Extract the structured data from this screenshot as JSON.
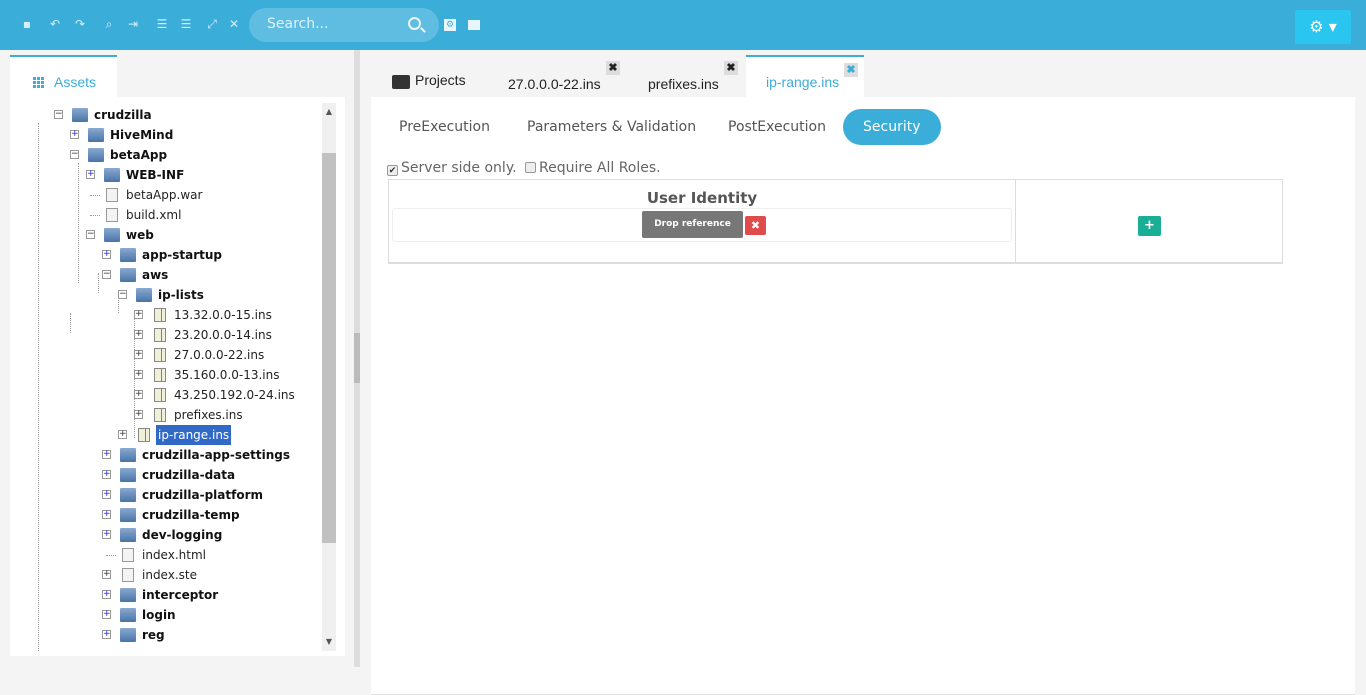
{
  "toolbar": {
    "icons": [
      "save-icon",
      "undo-icon",
      "redo-icon",
      "find-icon",
      "indent-icon",
      "align-left-icon",
      "align-right-icon",
      "expand-icon",
      "collapse-icon"
    ],
    "search_placeholder": "Search...",
    "settings_icon": "⚙ ▾"
  },
  "left": {
    "tab_label": "Assets",
    "tree": [
      {
        "level": 0,
        "toggle": "minus",
        "icon": "folder",
        "bold": true,
        "label": "crudzilla"
      },
      {
        "level": 1,
        "toggle": "plus",
        "icon": "folder-app",
        "bold": true,
        "label": "HiveMind"
      },
      {
        "level": 1,
        "toggle": "minus",
        "icon": "folder-app",
        "bold": true,
        "label": "betaApp"
      },
      {
        "level": 2,
        "toggle": "plus",
        "icon": "folder",
        "bold": true,
        "label": "WEB-INF"
      },
      {
        "level": 2,
        "toggle": "none",
        "icon": "file",
        "bold": false,
        "label": "betaApp.war"
      },
      {
        "level": 2,
        "toggle": "none",
        "icon": "xml",
        "bold": false,
        "label": "build.xml"
      },
      {
        "level": 2,
        "toggle": "minus",
        "icon": "folder-web",
        "bold": true,
        "label": "web"
      },
      {
        "level": 3,
        "toggle": "plus",
        "icon": "folder",
        "bold": true,
        "label": "app-startup"
      },
      {
        "level": 3,
        "toggle": "minus",
        "icon": "folder",
        "bold": true,
        "label": "aws"
      },
      {
        "level": 4,
        "toggle": "minus",
        "icon": "folder",
        "bold": true,
        "label": "ip-lists"
      },
      {
        "level": 5,
        "toggle": "plus",
        "icon": "ins",
        "bold": false,
        "label": "13.32.0.0-15.ins"
      },
      {
        "level": 5,
        "toggle": "plus",
        "icon": "ins",
        "bold": false,
        "label": "23.20.0.0-14.ins"
      },
      {
        "level": 5,
        "toggle": "plus",
        "icon": "ins",
        "bold": false,
        "label": "27.0.0.0-22.ins"
      },
      {
        "level": 5,
        "toggle": "plus",
        "icon": "ins",
        "bold": false,
        "label": "35.160.0.0-13.ins"
      },
      {
        "level": 5,
        "toggle": "plus",
        "icon": "ins",
        "bold": false,
        "label": "43.250.192.0-24.ins"
      },
      {
        "level": 5,
        "toggle": "plus",
        "icon": "ins",
        "bold": false,
        "label": "prefixes.ins"
      },
      {
        "level": 4,
        "toggle": "plus",
        "icon": "ins",
        "bold": false,
        "label": "ip-range.ins",
        "selected": true
      },
      {
        "level": 3,
        "toggle": "plus",
        "icon": "folder",
        "bold": true,
        "label": "crudzilla-app-settings"
      },
      {
        "level": 3,
        "toggle": "plus",
        "icon": "folder",
        "bold": true,
        "label": "crudzilla-data"
      },
      {
        "level": 3,
        "toggle": "plus",
        "icon": "folder",
        "bold": true,
        "label": "crudzilla-platform"
      },
      {
        "level": 3,
        "toggle": "plus",
        "icon": "folder",
        "bold": true,
        "label": "crudzilla-temp"
      },
      {
        "level": 3,
        "toggle": "plus",
        "icon": "folder",
        "bold": true,
        "label": "dev-logging"
      },
      {
        "level": 3,
        "toggle": "none",
        "icon": "file",
        "bold": false,
        "label": "index.html"
      },
      {
        "level": 3,
        "toggle": "plus",
        "icon": "file",
        "bold": false,
        "label": "index.ste"
      },
      {
        "level": 3,
        "toggle": "plus",
        "icon": "folder",
        "bold": true,
        "label": "interceptor"
      },
      {
        "level": 3,
        "toggle": "plus",
        "icon": "folder",
        "bold": true,
        "label": "login"
      },
      {
        "level": 3,
        "toggle": "plus",
        "icon": "folder",
        "bold": true,
        "label": "reg"
      }
    ]
  },
  "editor": {
    "tabs": [
      {
        "label": "Projects"
      },
      {
        "label": "27.0.0.0-22.ins"
      },
      {
        "label": "prefixes.ins"
      },
      {
        "label": "ip-range.ins"
      }
    ],
    "close_glyph": "✖",
    "subtabs": [
      "PreExecution",
      "Parameters & Validation",
      "PostExecution",
      "Security"
    ],
    "server_side_only": "Server side only.",
    "require_all_roles": "Require All Roles.",
    "server_side_checked": true,
    "require_all_checked": false,
    "user_identity": "User Identity",
    "drop_ref": "Drop reference here.",
    "delete_glyph": "✖",
    "add_glyph": "+"
  },
  "colors": {
    "accent": "#3badd9",
    "danger": "#e04c4c",
    "success": "#1aae95"
  }
}
